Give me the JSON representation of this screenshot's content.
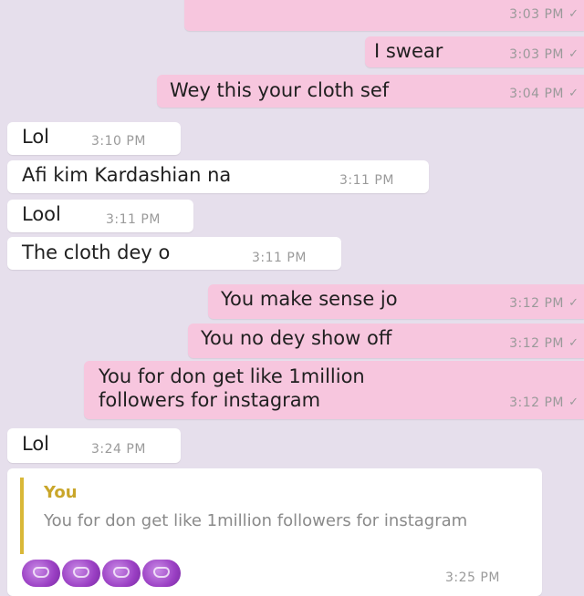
{
  "colors": {
    "background": "#e6dfec",
    "outgoing_bubble": "#f7c6de",
    "incoming_bubble": "#ffffff",
    "quote_accent": "#d9b838"
  },
  "messages": [
    {
      "dir": "out",
      "text": "",
      "time": "3:03 PM"
    },
    {
      "dir": "out",
      "text": "I swear",
      "time": "3:03 PM"
    },
    {
      "dir": "out",
      "text": "Wey this your cloth sef",
      "time": "3:04 PM"
    },
    {
      "dir": "in",
      "text": "Lol",
      "time": "3:10 PM"
    },
    {
      "dir": "in",
      "text": "Afi kim Kardashian na",
      "time": "3:11 PM"
    },
    {
      "dir": "in",
      "text": "Lool",
      "time": "3:11 PM"
    },
    {
      "dir": "in",
      "text": "The cloth dey o",
      "time": "3:11 PM"
    },
    {
      "dir": "out",
      "text": "You make sense jo",
      "time": "3:12 PM"
    },
    {
      "dir": "out",
      "text": "You no dey show off",
      "time": "3:12 PM"
    },
    {
      "dir": "out",
      "text_line1": "You for don get like 1million",
      "text_line2": "followers for instagram",
      "time": "3:12 PM"
    },
    {
      "dir": "in",
      "text": "Lol",
      "time": "3:24 PM"
    },
    {
      "dir": "in",
      "quote_author": "You",
      "quote_text": "You for don get like 1million followers for instagram",
      "emoji_icons": [
        "crying-laughing-emoji",
        "crying-laughing-emoji",
        "crying-laughing-emoji",
        "crying-laughing-emoji"
      ],
      "time": "3:25 PM"
    }
  ],
  "tick_glyph": "✓"
}
